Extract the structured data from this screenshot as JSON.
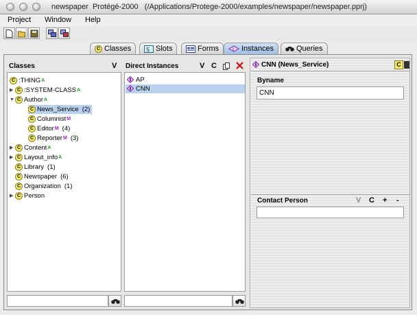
{
  "window": {
    "app": "newspaper",
    "product": "Protégé-2000",
    "path": "(/Applications/Protege-2000/examples/newspaper/newspaper.pprj)"
  },
  "menu": [
    "Project",
    "Window",
    "Help"
  ],
  "tabs": [
    {
      "label": "Classes",
      "icon": "classes-tab-icon"
    },
    {
      "label": "Slots",
      "icon": "slots-tab-icon"
    },
    {
      "label": "Forms",
      "icon": "forms-tab-icon"
    },
    {
      "label": "Instances",
      "icon": "instances-tab-icon"
    },
    {
      "label": "Queries",
      "icon": "binoculars-icon"
    }
  ],
  "classes": {
    "header": "Classes",
    "header_button": "V",
    "tree": [
      {
        "label": ":THING",
        "badge": "A",
        "count": ""
      },
      {
        "label": ":SYSTEM-CLASS",
        "badge": "A",
        "count": ""
      },
      {
        "label": "Author",
        "badge": "A",
        "count": ""
      },
      {
        "label": "News_Service",
        "badge": "",
        "count": "(2)"
      },
      {
        "label": "Columnist",
        "badge": "M",
        "count": ""
      },
      {
        "label": "Editor",
        "badge": "M",
        "count": "(4)"
      },
      {
        "label": "Reporter",
        "badge": "M",
        "count": "(3)"
      },
      {
        "label": "Content",
        "badge": "A",
        "count": ""
      },
      {
        "label": "Layout_info",
        "badge": "A",
        "count": ""
      },
      {
        "label": "Library",
        "badge": "",
        "count": "(1)"
      },
      {
        "label": "Newspaper",
        "badge": "",
        "count": "(6)"
      },
      {
        "label": "Organization",
        "badge": "",
        "count": "(1)"
      },
      {
        "label": "Person",
        "badge": "",
        "count": ""
      }
    ]
  },
  "instances": {
    "header": "Direct Instances",
    "buttons": [
      "V",
      "C"
    ],
    "items": [
      "AP",
      "CNN"
    ],
    "selected": "CNN"
  },
  "form": {
    "header": "CNN  (News_Service)",
    "header_badge": "C",
    "byname_label": "Byname",
    "byname_value": "CNN",
    "contact_label": "Contact Person",
    "contact_buttons": [
      "V",
      "C",
      "+",
      "-"
    ]
  },
  "colors": {
    "selection": "#b9d1ee",
    "class_icon": "#f6ee6a",
    "abstract_badge": "#1f9a1f",
    "metaclass_badge": "#a020c0",
    "active_tab": "#9fbde3",
    "delete_red": "#cc1111"
  }
}
